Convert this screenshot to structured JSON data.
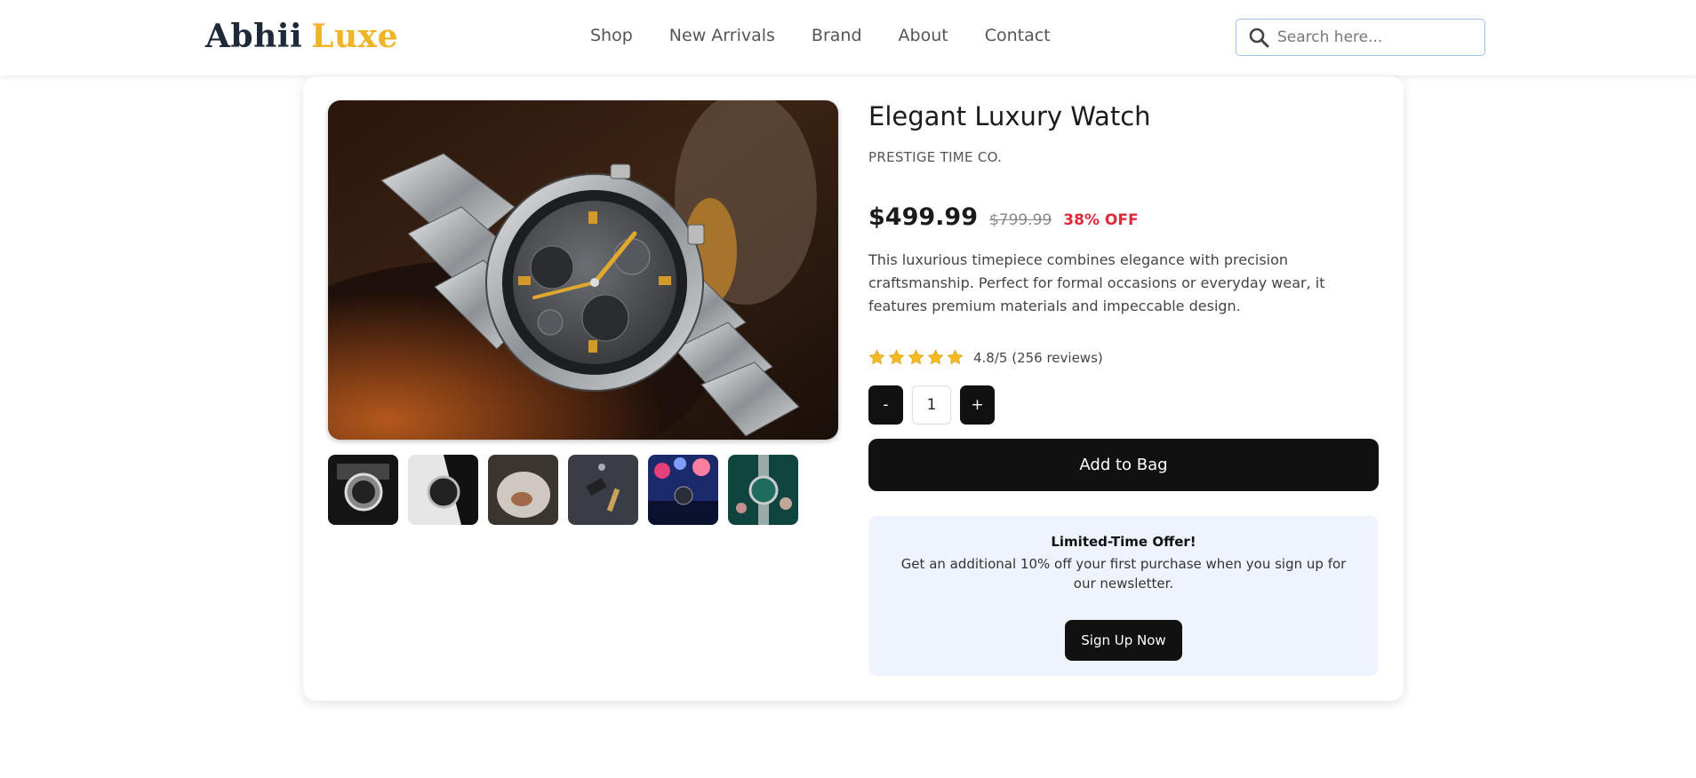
{
  "header": {
    "logo_part1": "Abhii",
    "logo_part2": "Luxe",
    "nav": [
      "Shop",
      "New Arrivals",
      "Brand",
      "About",
      "Contact"
    ],
    "search_placeholder": "Search here..."
  },
  "product": {
    "title": "Elegant Luxury Watch",
    "brand": "PRESTIGE TIME CO.",
    "price": "$499.99",
    "original_price": "$799.99",
    "discount": "38% OFF",
    "description": "This luxurious timepiece combines elegance with precision craftsmanship. Perfect for formal occasions or everyday wear, it features premium materials and impeccable design.",
    "rating_value": 4.8,
    "star_count": 5,
    "rating_text": "4.8/5 (256 reviews)",
    "quantity": "1",
    "decrement_label": "-",
    "increment_label": "+",
    "add_to_bag_label": "Add to Bag",
    "thumbnail_count": 6
  },
  "offer": {
    "title": "Limited-Time Offer!",
    "text": "Get an additional 10% off your first purchase when you sign up for our newsletter.",
    "button_label": "Sign Up Now"
  },
  "colors": {
    "logo_dark": "#1e2a3a",
    "logo_gold": "#f0b429",
    "discount_red": "#e0283a",
    "button_black": "#111111",
    "offer_bg": "#eef3fd",
    "star_gold": "#f5b921"
  },
  "icons": {
    "search": "search-icon",
    "star": "star-icon"
  }
}
